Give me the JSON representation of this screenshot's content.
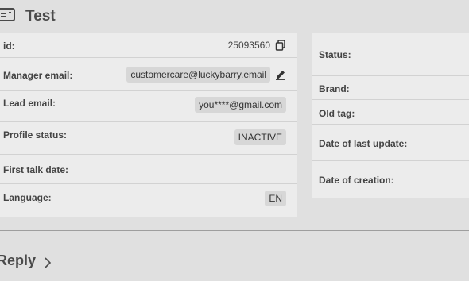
{
  "header": {
    "title": "Test",
    "icon": "id-card-icon"
  },
  "left_panel": {
    "id": {
      "label": "id:",
      "value": "25093560",
      "icon": "copy-icon"
    },
    "manager_email": {
      "label": "Manager email:",
      "value": "customercare@luckybarry.email",
      "icon": "edit-icon"
    },
    "lead_email": {
      "label": "Lead email:",
      "value": "you****@gmail.com"
    },
    "profile_status": {
      "label": "Profile status:",
      "value": "INACTIVE"
    },
    "first_talk_date": {
      "label": "First talk date:",
      "value": ""
    },
    "language": {
      "label": "Language:",
      "value": "EN"
    }
  },
  "right_panel": {
    "status": {
      "label": "Status:"
    },
    "brand": {
      "label": "Brand:"
    },
    "old_tag": {
      "label": "Old tag:"
    },
    "last_update": {
      "label": "Date of last update:"
    },
    "creation": {
      "label": "Date of creation:"
    }
  },
  "reply": {
    "label": "Reply",
    "icon": "chevron-right-icon"
  }
}
